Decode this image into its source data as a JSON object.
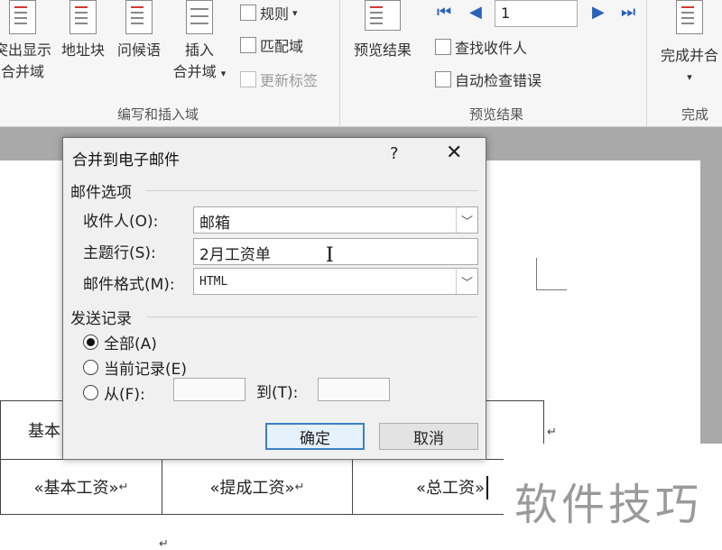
{
  "ribbon": {
    "group_write_insert": {
      "label": "编写和插入域",
      "btn_highlight_line1": "突出显示",
      "btn_highlight_line2": "合并域",
      "btn_address_block": "地址块",
      "btn_greeting": "问候语",
      "btn_insert_line1": "插入",
      "btn_insert_line2": "合并域",
      "rules": "规则",
      "match_fields": "匹配域",
      "update_labels": "更新标签"
    },
    "group_preview": {
      "label": "预览结果",
      "btn_preview": "预览结果",
      "record_number": "1",
      "find_recipient": "查找收件人",
      "auto_check": "自动检查错误"
    },
    "group_finish": {
      "label": "完成",
      "btn_finish": "完成并合"
    }
  },
  "dialog": {
    "title": "合并到电子邮件",
    "help": "?",
    "close": "✕",
    "mail_options": "邮件选项",
    "to_label": "收件人(O):",
    "to_value": "邮箱",
    "subject_label": "主题行(S):",
    "subject_value": "2月工资单",
    "format_label": "邮件格式(M):",
    "format_value": "HTML",
    "send_records": "发送记录",
    "radio_all": "全部(A)",
    "radio_current": "当前记录(E)",
    "radio_from": "从(F):",
    "to_range_label": "到(T):",
    "selected": "all",
    "ok": "确定",
    "cancel": "取消"
  },
  "document": {
    "cell_partial": "基本",
    "cell_basic_salary": "«基本工资»",
    "cell_commission": "«提成工资»",
    "cell_total": "«总工资»",
    "para_mark": "↵"
  },
  "watermark": "软件技巧"
}
